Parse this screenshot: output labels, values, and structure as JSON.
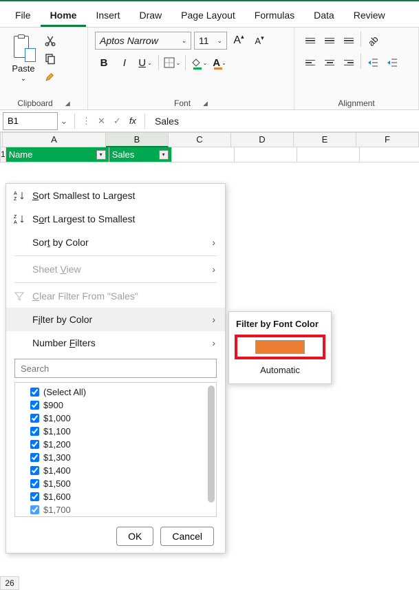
{
  "menu": {
    "items": [
      "File",
      "Home",
      "Insert",
      "Draw",
      "Page Layout",
      "Formulas",
      "Data",
      "Review"
    ],
    "active": 1
  },
  "ribbon": {
    "clipboard": {
      "paste": "Paste",
      "paste_dd": "⌄",
      "label": "Clipboard"
    },
    "font": {
      "name": "Aptos Narrow",
      "size": "11",
      "bold": "B",
      "italic": "I",
      "underline": "U",
      "label": "Font"
    },
    "alignment": {
      "label": "Alignment"
    }
  },
  "namebox": "B1",
  "formula": "Sales",
  "columns": [
    "A",
    "B",
    "C",
    "D",
    "E",
    "F"
  ],
  "row1": "1",
  "headers": {
    "a": "Name",
    "b": "Sales"
  },
  "row26": "26",
  "sort_menu": {
    "small_large": "Sort Smallest to Largest",
    "large_small": "Sort Largest to Smallest",
    "by_color": "Sort by Color",
    "sheet_view": "Sheet View",
    "clear": "Clear Filter From \"Sales\"",
    "filter_color": "Filter by Color",
    "number_filters": "Number Filters",
    "search_ph": "Search",
    "items": [
      "(Select All)",
      "$900",
      "$1,000",
      "$1,100",
      "$1,200",
      "$1,300",
      "$1,400",
      "$1,500",
      "$1,600",
      "$1,700"
    ],
    "ok": "OK",
    "cancel": "Cancel"
  },
  "submenu": {
    "title": "Filter by Font Color",
    "color": "#ed7d31",
    "automatic": "Automatic"
  }
}
